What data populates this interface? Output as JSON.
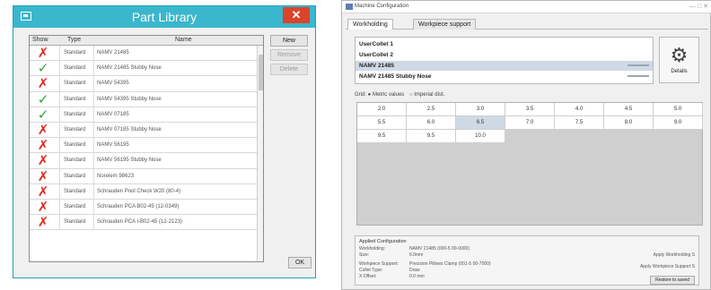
{
  "part_library": {
    "title": "Part Library",
    "close_glyph": "✕",
    "columns": [
      "Show",
      "Type",
      "Name"
    ],
    "rows": [
      {
        "show": "hidden",
        "type": "Standard",
        "name": "NAMV 21485"
      },
      {
        "show": "visible",
        "type": "Standard",
        "name": "NAMV 21485 Stubby Nose"
      },
      {
        "show": "hidden",
        "type": "Standard",
        "name": "NAMV 54395"
      },
      {
        "show": "visible",
        "type": "Standard",
        "name": "NAMV 54395 Stubby Nose"
      },
      {
        "show": "visible",
        "type": "Standard",
        "name": "NAMV 07185"
      },
      {
        "show": "hidden",
        "type": "Standard",
        "name": "NAMV 07185 Stubby Nose"
      },
      {
        "show": "hidden",
        "type": "Standard",
        "name": "NAMV 56195"
      },
      {
        "show": "hidden",
        "type": "Standard",
        "name": "NAMV 56195 Stubby Nose"
      },
      {
        "show": "hidden",
        "type": "Standard",
        "name": "Norelem 98623"
      },
      {
        "show": "hidden",
        "type": "Standard",
        "name": "Schrauden Pool Check W20 (80-4)"
      },
      {
        "show": "hidden",
        "type": "Standard",
        "name": "Schrauden PCA B02-45 (12-0349)"
      },
      {
        "show": "hidden",
        "type": "Standard",
        "name": "Schrauden PCA I-B02-45 (12-2123)"
      }
    ],
    "buttons": {
      "new": "New",
      "remove": "Remove",
      "delete": "Delete",
      "ok": "OK"
    },
    "glyphs": {
      "hidden": "✗",
      "visible": "✓"
    },
    "colors": {
      "title_bar": "#3ab7cc",
      "close": "#d9442b",
      "hidden_mark": "#e02a1f",
      "visible_mark": "#2da83a"
    }
  },
  "machine_config": {
    "title": "Machine Configuration",
    "window_controls": "—  □  ✕",
    "tabs": [
      "Workholding",
      "Workpiece support"
    ],
    "list_items": [
      "UserCollet 1",
      "UserCollet 2",
      "NAMV 21485",
      "NAMV 21485 Stubby Nose"
    ],
    "selected_index": 2,
    "settings_label": "Details",
    "radio_labels": [
      "Grid: ● Metric values",
      "○ Imperial dist."
    ],
    "grid_values": [
      [
        "2.0",
        "2.5",
        "3.0",
        "3.5",
        "4.0",
        "4.5",
        "5.0"
      ],
      [
        "5.5",
        "6.0",
        "6.5",
        "7.0",
        "7.5",
        "8.0",
        "9.0"
      ],
      [
        "9.5",
        "9.5",
        "10.0"
      ]
    ],
    "highlight_cell": "6.5",
    "info": {
      "header": "Applied Configuration",
      "rows": [
        {
          "key": "Workholding:",
          "value": "NAMV 21485 (000-5 00-0000)"
        },
        {
          "key": "Size:",
          "value": "6.0mm"
        },
        {
          "key": "Workpiece Support:",
          "value": "Precision Pillows Clamp (001-5 00-7000)"
        },
        {
          "key": "Collet Type:",
          "value": "Draw"
        },
        {
          "key": "X Offset:",
          "value": "0.0 mm"
        }
      ],
      "right_labels": [
        "Apply Workholding S",
        "Apply Workpiece Support S"
      ],
      "button": "Restore to saved"
    },
    "gear_glyph": "⚙"
  }
}
